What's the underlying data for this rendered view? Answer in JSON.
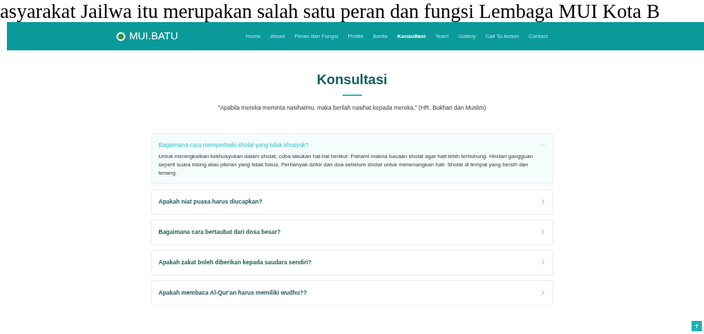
{
  "background_text": "asyarakat Jailwa itu merupakan salah satu peran dan fungsi Lembaga MUI Kota B",
  "navbar": {
    "logo": "MUI.BATU",
    "items": [
      {
        "label": "Home",
        "selected": false
      },
      {
        "label": "About",
        "selected": false
      },
      {
        "label": "Peran dan Fungsi",
        "selected": false
      },
      {
        "label": "Profile",
        "selected": false
      },
      {
        "label": "Berita",
        "selected": false
      },
      {
        "label": "Konsultasi",
        "selected": true
      },
      {
        "label": "Team",
        "selected": false
      },
      {
        "label": "Gallery",
        "selected": false
      },
      {
        "label": "Call To Action",
        "selected": false
      },
      {
        "label": "Contact",
        "selected": false
      }
    ]
  },
  "section": {
    "title": "Konsultasi",
    "quote": "\"Apabila mereka meminta nasihatmu, maka berilah nasihat kepada mereka.\" (HR. Bukhari dan Muslim)"
  },
  "faq": [
    {
      "question": "Bagaimana cara memperbaiki sholat yang tidak khusyuk?",
      "expanded": true,
      "answer": "Untuk meningkatkan kekhusyukan dalam sholat, coba lakukan hal-hal berikut: Pahami makna bacaan sholat agar hati lebih terhubung. Hindari gangguan seperti suara bising atau pikiran yang tidak fokus. Perbanyak dzikir dan doa sebelum sholat untuk menenangkan hati. Sholat di tempat yang bersih dan tenang."
    },
    {
      "question": "Apakah niat puasa harus diucapkan?",
      "expanded": false
    },
    {
      "question": "Bagaimana cara bertaubat dari dosa besar?",
      "expanded": false
    },
    {
      "question": "Apakah zakat boleh diberikan kepada saudara sendiri?",
      "expanded": false
    },
    {
      "question": "Apakah membaca Al-Qur'an harus memiliki wudhu??",
      "expanded": false
    }
  ]
}
